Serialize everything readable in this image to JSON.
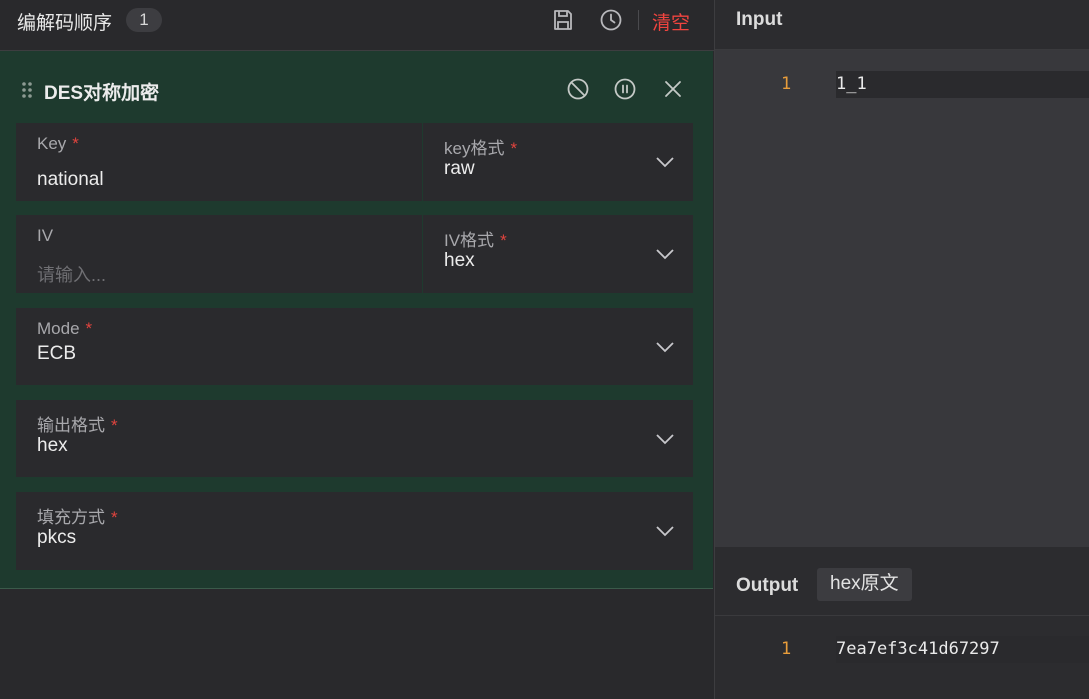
{
  "header": {
    "title": "编解码顺序",
    "count": "1",
    "save_icon": "save-icon",
    "history_icon": "history-icon",
    "clear_label": "清空"
  },
  "card": {
    "title": "DES对称加密",
    "icons": [
      "drag-handle-icon",
      "disable-icon",
      "pause-icon",
      "close-icon"
    ],
    "fields": {
      "key": {
        "label": "Key",
        "star": "*",
        "value": "national"
      },
      "key_format": {
        "label": "key格式",
        "star": "*",
        "value": "raw"
      },
      "iv": {
        "label": "IV",
        "placeholder": "请输入..."
      },
      "iv_format": {
        "label": "IV格式",
        "star": "*",
        "value": "hex"
      },
      "mode": {
        "label": "Mode",
        "star": "*",
        "value": "ECB"
      },
      "output_format": {
        "label": "输出格式",
        "star": "*",
        "value": "hex"
      },
      "padding": {
        "label": "填充方式",
        "star": "*",
        "value": "pkcs"
      }
    }
  },
  "input": {
    "label": "Input",
    "lines": [
      {
        "no": "1",
        "text": "1_1"
      }
    ]
  },
  "output": {
    "label": "Output",
    "tag": "hex原文",
    "lines": [
      {
        "no": "1",
        "text": "7ea7ef3c41d67297"
      }
    ]
  },
  "colors": {
    "accent_red": "#f0443f",
    "card_bg": "#1e3a2e",
    "line_number": "#e89d3b"
  }
}
